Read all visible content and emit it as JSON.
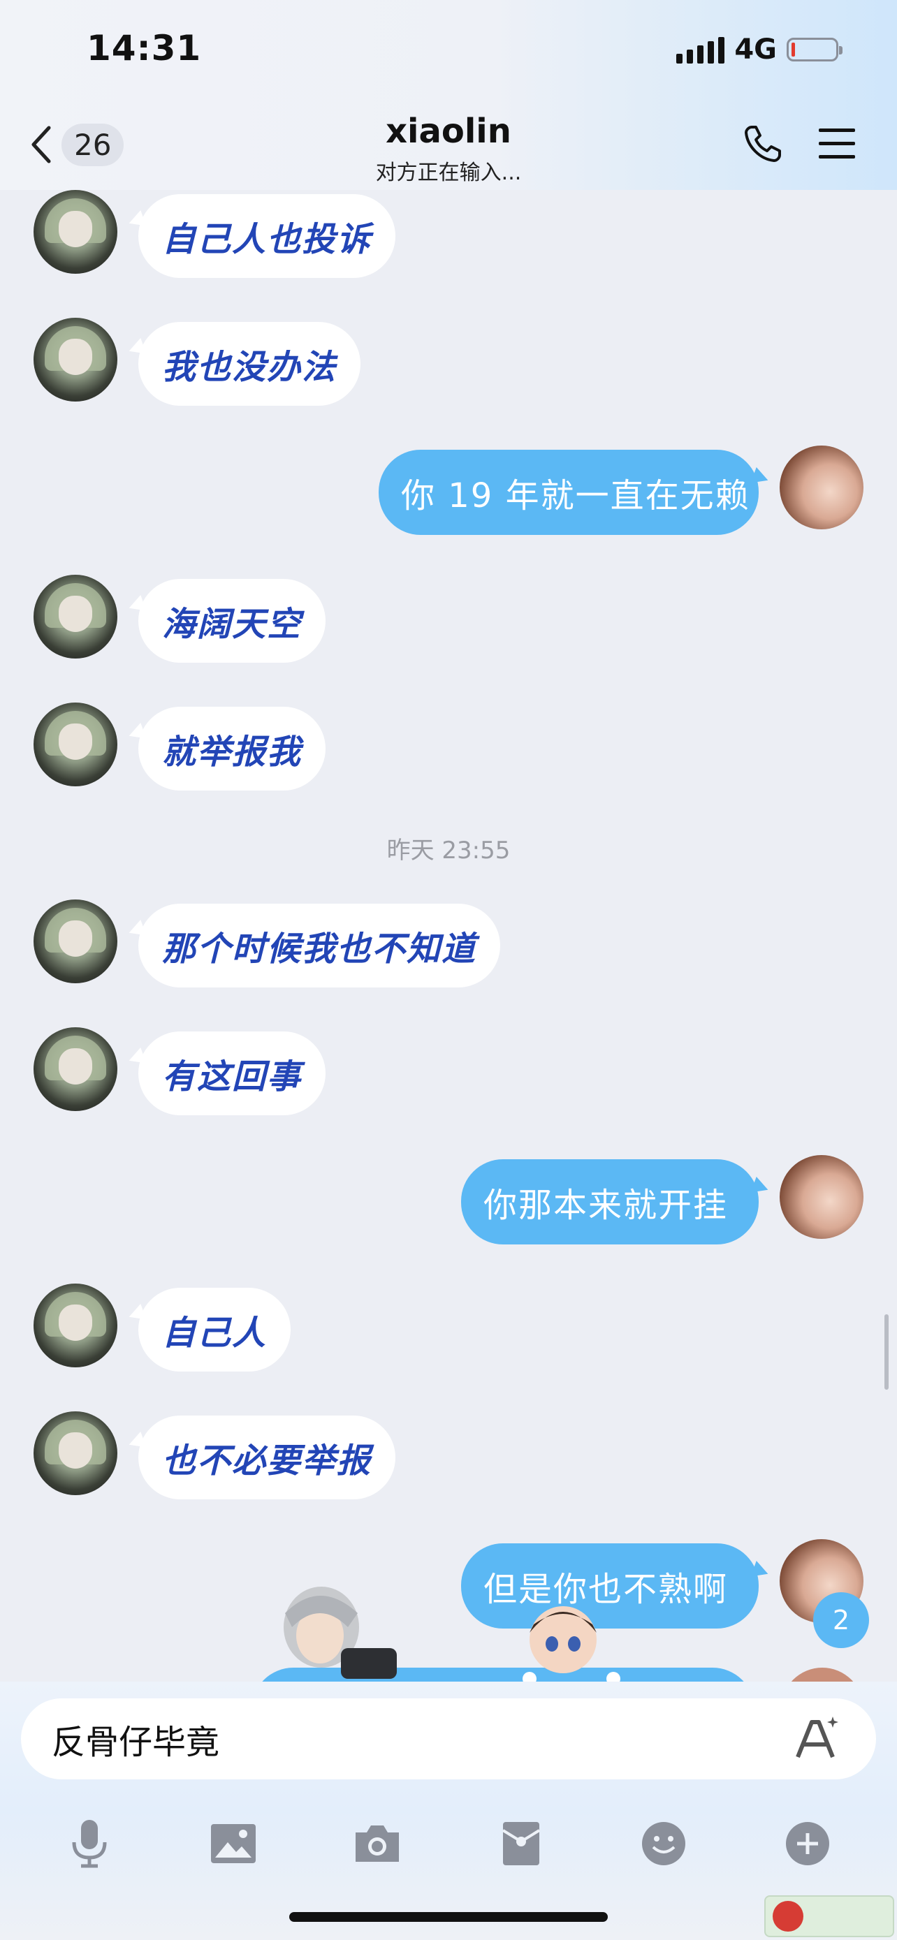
{
  "status_bar": {
    "time": "14:31",
    "network": "4G"
  },
  "header": {
    "unread_count": "26",
    "title": "xiaolin",
    "subtitle": "对方正在输入..."
  },
  "messages": [
    {
      "side": "left",
      "text": "自己人也投诉"
    },
    {
      "side": "left",
      "text": "我也没办法"
    },
    {
      "side": "right",
      "text": "你 19 年就一直在无赖"
    },
    {
      "side": "left",
      "text": "海阔天空"
    },
    {
      "side": "left",
      "text": "就举报我"
    },
    {
      "side": "left",
      "text": "那个时候我也不知道"
    },
    {
      "side": "left",
      "text": "有这回事"
    },
    {
      "side": "right",
      "text": "你那本来就开挂"
    },
    {
      "side": "left",
      "text": "自己人"
    },
    {
      "side": "left",
      "text": "也不必要举报"
    },
    {
      "side": "right",
      "text": "但是你也不熟啊"
    }
  ],
  "timestamp": "昨天 23:55",
  "new_message_badge": "2",
  "input": {
    "value": "反骨仔毕竟"
  },
  "toolbar": {
    "icons": [
      "microphone-icon",
      "image-icon",
      "camera-icon",
      "red-packet-icon",
      "emoji-icon",
      "plus-icon"
    ]
  },
  "colors": {
    "accent": "#5bb8f4",
    "left_text": "#2245b6",
    "background": "#eceef4"
  }
}
